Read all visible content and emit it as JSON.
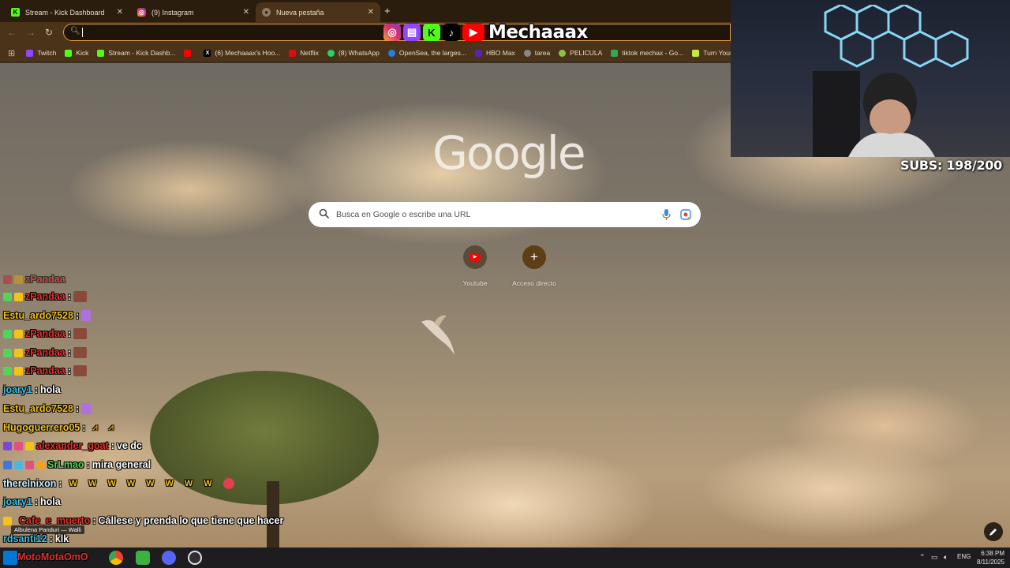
{
  "browser": {
    "tabs": [
      {
        "title": "Stream - Kick Dashboard",
        "icon": "kick-icon",
        "active": false
      },
      {
        "title": "(9) Instagram",
        "icon": "instagram-icon",
        "active": false
      },
      {
        "title": "Nueva pestaña",
        "icon": "chrome-icon",
        "active": true
      }
    ],
    "omnibox_value": "",
    "bookmarks": [
      {
        "label": "Twitch",
        "icon": "twitch-icon",
        "color": "#9146ff"
      },
      {
        "label": "Kick",
        "icon": "kick-icon",
        "color": "#53fc18"
      },
      {
        "label": "Stream - Kick Dashb...",
        "icon": "kick-icon",
        "color": "#53fc18"
      },
      {
        "label": "",
        "icon": "youtube-icon",
        "color": "#ff0000"
      },
      {
        "label": "(6) Mechaaax's Hoo...",
        "icon": "x-icon",
        "color": "#000000"
      },
      {
        "label": "Netflix",
        "icon": "netflix-icon",
        "color": "#e50914"
      },
      {
        "label": "(8) WhatsApp",
        "icon": "whatsapp-icon",
        "color": "#25d366"
      },
      {
        "label": "OpenSea, the larges...",
        "icon": "opensea-icon",
        "color": "#2081e2"
      },
      {
        "label": "HBO Max",
        "icon": "hbomax-icon",
        "color": "#5822b4"
      },
      {
        "label": "tarea",
        "icon": "globe-icon",
        "color": "#888888"
      },
      {
        "label": "PELICULA",
        "icon": "film-icon",
        "color": "#8bc34a"
      },
      {
        "label": "tiktok mechax - Go...",
        "icon": "drive-icon",
        "color": "#34a853"
      },
      {
        "label": "Turn Your Skins in",
        "icon": "skins-icon",
        "color": "#c6e73c"
      }
    ]
  },
  "overlay": {
    "streamer_name": "Mechaaax",
    "subs_text": "SUBS: 198/200"
  },
  "newtab": {
    "logo": "Google",
    "search_placeholder": "Busca en Google o escribe una URL",
    "shortcuts": [
      {
        "label": "Youtube",
        "icon": "youtube-icon"
      },
      {
        "label": "Acceso directo",
        "icon": "plus-icon"
      }
    ]
  },
  "chat": [
    {
      "user": "zPandaa",
      "color": "#e0312d",
      "message": "",
      "emotes": 1,
      "badges": 2
    },
    {
      "user": "Estu_ardo7528",
      "color": "#f4c21a",
      "message": "",
      "emotes": 1,
      "badges": 0
    },
    {
      "user": "zPandaa",
      "color": "#e0312d",
      "message": "",
      "emotes": 1,
      "badges": 2
    },
    {
      "user": "zPandaa",
      "color": "#e0312d",
      "message": "",
      "emotes": 1,
      "badges": 2
    },
    {
      "user": "zPandaa",
      "color": "#e0312d",
      "message": "",
      "emotes": 1,
      "badges": 2
    },
    {
      "user": "joary1",
      "color": "#3dc1e6",
      "message": "hola",
      "emotes": 0,
      "badges": 0
    },
    {
      "user": "Estu_ardo7528",
      "color": "#f4c21a",
      "message": "",
      "emotes": 1,
      "badges": 0
    },
    {
      "user": "Hugoguerrero05",
      "color": "#f4c21a",
      "message": "",
      "emotes": 2,
      "badges": 0
    },
    {
      "user": "alexander_goat",
      "color": "#e0312d",
      "message": "ve dc",
      "emotes": 0,
      "badges": 3
    },
    {
      "user": "SrLmao",
      "color": "#53d35a",
      "message": "mira general",
      "emotes": 0,
      "badges": 4
    },
    {
      "user": "therelnixon",
      "color": "#c8f0ff",
      "message": "",
      "emotes": 9,
      "badges": 0
    },
    {
      "user": "joary1",
      "color": "#3dc1e6",
      "message": "hola",
      "emotes": 0,
      "badges": 0
    },
    {
      "user": "Cafe_e_muerto",
      "color": "#e0312d",
      "message": "Cállese y prenda lo que tiene que hacer",
      "emotes": 0,
      "badges": 1
    },
    {
      "user": "rdsanti12",
      "color": "#3dc1e6",
      "message": "klk",
      "emotes": 0,
      "badges": 0
    }
  ],
  "now_playing": {
    "label": "Albulena Panduri — Walli"
  },
  "taskbar": {
    "stream_name_overlay": "MotoMotaOmO",
    "language": "ENG",
    "time": "6:38 PM",
    "date": "8/11/2025"
  }
}
